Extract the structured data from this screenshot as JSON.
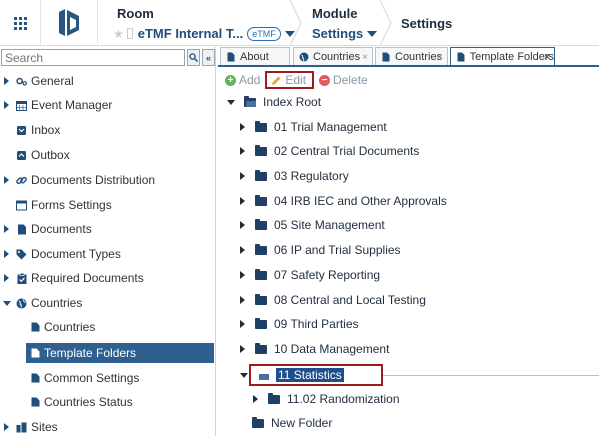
{
  "header": {
    "room_label": "Room",
    "room_name": "eTMF Internal T...",
    "room_badge": "eTMF",
    "module_label": "Module",
    "module_value": "Settings",
    "page_title": "Settings"
  },
  "sidebar": {
    "search_placeholder": "Search",
    "items": [
      {
        "label": "General",
        "icon": "gears-icon",
        "expandable": true
      },
      {
        "label": "Event Manager",
        "icon": "calendar-icon",
        "expandable": true
      },
      {
        "label": "Inbox",
        "icon": "inbox-icon",
        "expandable": false
      },
      {
        "label": "Outbox",
        "icon": "outbox-icon",
        "expandable": false
      },
      {
        "label": "Documents Distribution",
        "icon": "link-icon",
        "expandable": true
      },
      {
        "label": "Forms Settings",
        "icon": "form-icon",
        "expandable": false
      },
      {
        "label": "Documents",
        "icon": "document-icon",
        "expandable": true
      },
      {
        "label": "Document Types",
        "icon": "tag-icon",
        "expandable": true
      },
      {
        "label": "Required Documents",
        "icon": "clipboard-icon",
        "expandable": true
      },
      {
        "label": "Countries",
        "icon": "globe-icon",
        "expandable": true,
        "expanded": true
      }
    ],
    "country_children": [
      {
        "label": "Countries"
      },
      {
        "label": "Template Folders",
        "active": true
      },
      {
        "label": "Common Settings"
      },
      {
        "label": "Countries Status"
      }
    ],
    "last_item": {
      "label": "Sites",
      "icon": "sites-icon"
    }
  },
  "tabs": [
    {
      "label": "About",
      "icon": "document-icon",
      "active": false
    },
    {
      "label": "Countries",
      "icon": "globe-icon",
      "active": false
    },
    {
      "label": "Countries",
      "icon": "document-icon",
      "active": false
    },
    {
      "label": "Template Folders",
      "icon": "document-icon",
      "active": true
    }
  ],
  "tab_close_glyph": "×",
  "toolbar": {
    "add_label": "Add",
    "edit_label": "Edit",
    "delete_label": "Delete"
  },
  "tree": {
    "root": "Index Root",
    "folders": [
      "01 Trial Management",
      "02 Central Trial Documents",
      "03 Regulatory",
      "04 IRB IEC and Other Approvals",
      "05 Site Management",
      "06 IP and Trial Supplies",
      "07 Safety Reporting",
      "08 Central and Local Testing",
      "09 Third Parties",
      "10 Data Management"
    ],
    "selected": "11 Statistics",
    "selected_child": "11.02 Randomization",
    "new_folder": "New Folder"
  },
  "colors": {
    "accent": "#2f5f8f",
    "highlight_border": "#9b1c1c",
    "add_green": "#5cb85c",
    "edit_orange": "#e8a33d",
    "delete_red": "#e05b5b"
  }
}
